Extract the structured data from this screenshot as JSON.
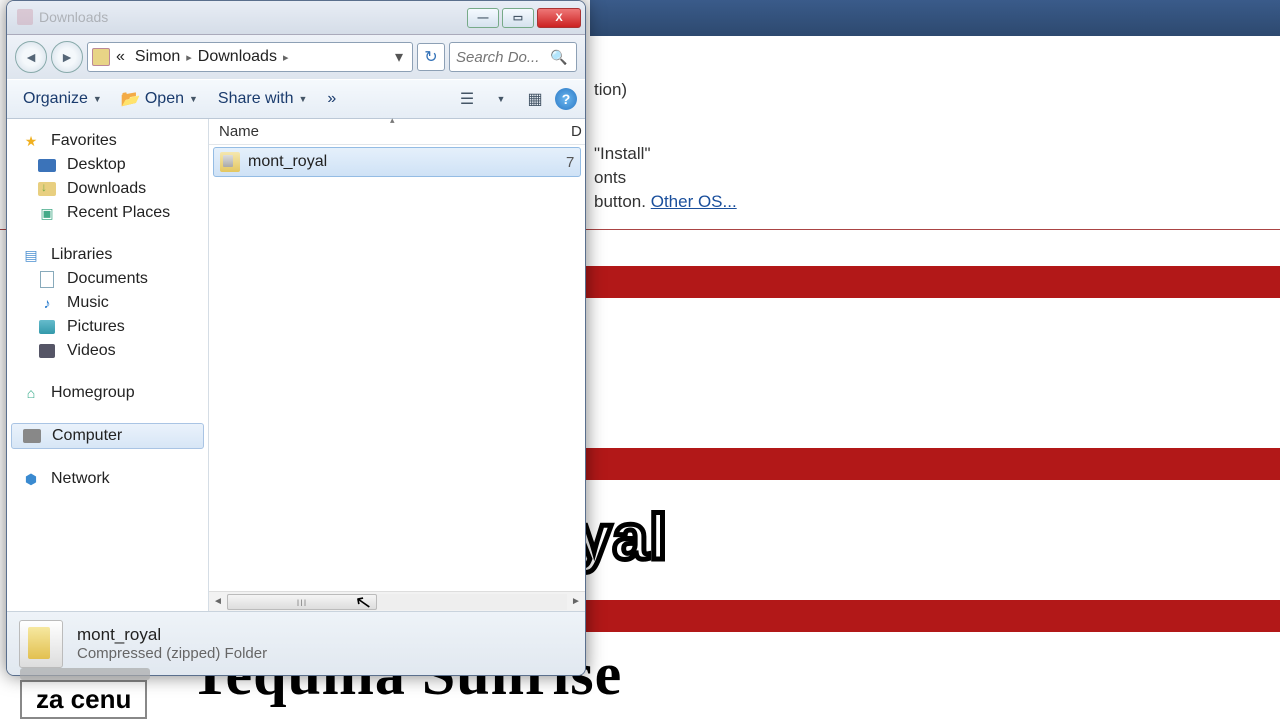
{
  "bg": {
    "line1": "tion)",
    "line2": "\"Install\"",
    "line3": "onts",
    "line4_pre": " button. ",
    "line4_link": "Other OS...",
    "preview1": "yal",
    "preview2": "Tequilla Sunrise",
    "box": "za cenu"
  },
  "window": {
    "title_hint": "Downloads"
  },
  "winbtn": {
    "min": "—",
    "max": "▭",
    "close": "X"
  },
  "nav": {
    "back": "◄",
    "forward": "►"
  },
  "address": {
    "prefix": "«",
    "seg1": "Simon",
    "seg2": "Downloads",
    "sep": "▸",
    "dropdown": "▾",
    "refresh": "↻"
  },
  "search": {
    "placeholder": "Search Do..."
  },
  "toolbar": {
    "organize": "Organize",
    "open": "Open",
    "share": "Share with",
    "more": "»",
    "help": "?"
  },
  "sidebar": {
    "favorites": "Favorites",
    "desktop": "Desktop",
    "downloads": "Downloads",
    "recent": "Recent Places",
    "libraries": "Libraries",
    "documents": "Documents",
    "music": "Music",
    "pictures": "Pictures",
    "videos": "Videos",
    "homegroup": "Homegroup",
    "computer": "Computer",
    "network": "Network"
  },
  "columns": {
    "name": "Name",
    "d": "D",
    "sort": "▴"
  },
  "files": [
    {
      "name": "mont_royal",
      "d": "7"
    }
  ],
  "scroll": {
    "left": "◄",
    "right": "►",
    "grip": "III"
  },
  "details": {
    "name": "mont_royal",
    "type": "Compressed (zipped) Folder"
  }
}
